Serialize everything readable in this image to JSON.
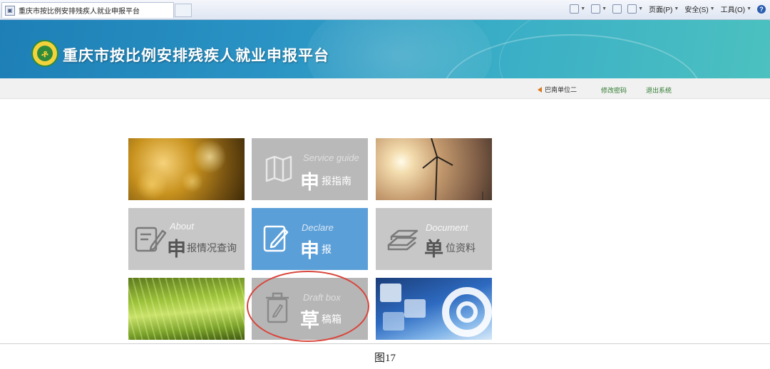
{
  "browser": {
    "tab_title": "重庆市按比例安排残疾人就业申报平台",
    "page_menu": "页面(P)",
    "safety_menu": "安全(S)",
    "tools_menu": "工具(O)"
  },
  "header": {
    "title": "重庆市按比例安排残疾人就业申报平台"
  },
  "user_bar": {
    "unit_name": "巴南单位二",
    "change_password": "修改密码",
    "logout": "退出系统"
  },
  "tiles": {
    "guide": {
      "en": "Service guide",
      "char": "申",
      "text": "报指南"
    },
    "query": {
      "en": "About",
      "char": "申",
      "text": "报情况查询"
    },
    "declare": {
      "en": "Declare",
      "char": "申",
      "text": "报"
    },
    "unit": {
      "en": "Document",
      "char": "单",
      "text": "位资料"
    },
    "draft": {
      "en": "Draft box",
      "char": "草",
      "text": "稿箱"
    }
  },
  "caption": "图17",
  "colors": {
    "banner": "#2a93c4",
    "declare_tile": "#5b9fd8",
    "gray_tile": "#c7c7c7",
    "highlight_oval": "#d9443b",
    "link": "#2f7a2f"
  }
}
